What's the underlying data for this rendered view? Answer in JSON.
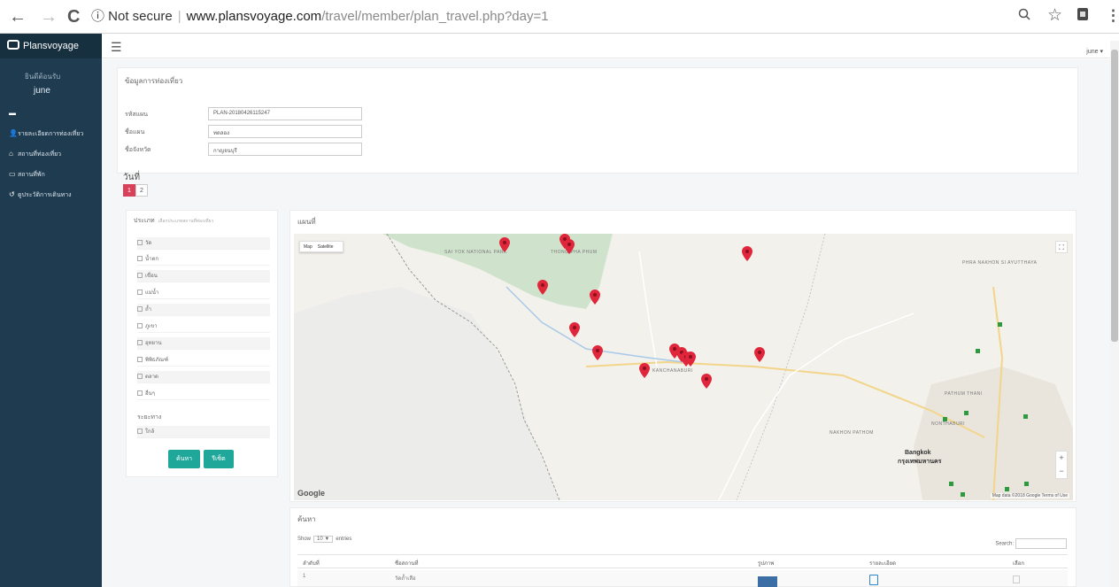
{
  "browser": {
    "back": "←",
    "forward": "→",
    "reload": "C",
    "security": "ⓘ Not secure",
    "url_host": "www.plansvoyage.com",
    "url_path": "/travel/member/plan_travel.php?day=1",
    "zoom_icon": "search-icon",
    "star_icon": "star-icon",
    "ext_icon": "extension-icon",
    "menu_icon": "kebab-icon"
  },
  "sidebar": {
    "brand": "Plansvoyage",
    "user_caption": "ยินดีต้อนรับ",
    "user_name": "june",
    "items": [
      {
        "icon": "minus-icon",
        "label": ""
      },
      {
        "icon": "user-icon",
        "label": "รายละเอียดการท่องเที่ยว"
      },
      {
        "icon": "home-icon",
        "label": "สถานที่ท่องเที่ยว"
      },
      {
        "icon": "bed-icon",
        "label": "สถานที่พัก"
      },
      {
        "icon": "history-icon",
        "label": "ดูประวัติการเดินทาง"
      }
    ]
  },
  "header": {
    "menu_icon": "hamburger-icon",
    "user_menu": "june"
  },
  "plan": {
    "title": "ข้อมูลการท่องเที่ยว",
    "fields": [
      {
        "label": "รหัสแผน",
        "value": "PLAN-20180426115247"
      },
      {
        "label": "ชื่อแผน",
        "value": "ทดลอง"
      },
      {
        "label": "ชื่อจังหวัด",
        "value": "กาญจนบุรี"
      }
    ]
  },
  "days": {
    "label": "วันที่",
    "buttons": [
      "1",
      "2"
    ],
    "active": "1"
  },
  "filter": {
    "heading": "ประเภท",
    "subheading": "เลือกประเภทสถานที่ท่องเที่ยว",
    "categories": [
      "วัด",
      "น้ำตก",
      "เขื่อน",
      "แม่น้ำ",
      "ถ้ำ",
      "ภูเขา",
      "อุทยาน",
      "พิพิธภัณฑ์",
      "ตลาด",
      "อื่นๆ"
    ],
    "distance_label": "ระยะทาง",
    "distance_option": "ใกล้",
    "search_button": "ค้นหา",
    "reset_button": "รีเซ็ต"
  },
  "map": {
    "title": "แผนที่",
    "type_map": "Map",
    "type_satellite": "Satellite",
    "labels": [
      "SAI YOK NATIONAL PARK",
      "THONG PHA PHUM",
      "KANCHANABURI",
      "NAKHON PATHOM",
      "Bangkok",
      "กรุงเทพมหานคร",
      "NONTHABURI",
      "PATHUM THANI",
      "PHRA NAKHON SI AYUTTHAYA"
    ],
    "google": "Google",
    "attribution": "Map data ©2018 Google  Terms of Use",
    "marker_color": "#e0263b",
    "park_color": "#cfe3cc"
  },
  "results": {
    "title": "ค้นหา",
    "show_prefix": "Show",
    "show_value": "10",
    "show_suffix": "entries",
    "search_label": "Search:",
    "columns": [
      "ลำดับที่",
      "ชื่อสถานที่",
      "รูปภาพ",
      "รายละเอียด",
      "เลือก"
    ],
    "rows": [
      {
        "index": "1",
        "name": "วัดถ้ำเสือ"
      }
    ]
  }
}
